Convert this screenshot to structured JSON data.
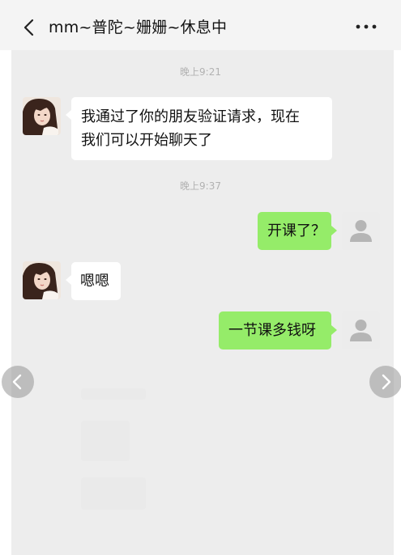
{
  "header": {
    "title": "mm~普陀~姗姗~休息中",
    "back_icon": "chevron-left-icon",
    "more_icon": "more-dots-icon"
  },
  "messages": {
    "time1": "晚上9:21",
    "msg1_line1": "我通过了你的朋友验证请求，现在",
    "msg1_line2": "我们可以开始聊天了",
    "time2": "晚上9:37",
    "msg2": "开课了？",
    "msg3": "嗯嗯",
    "msg4": "一节课多钱呀"
  },
  "viewer": {
    "prev_icon": "chevron-left-icon",
    "next_icon": "chevron-right-icon"
  },
  "colors": {
    "sent_bubble": "#95ec69",
    "received_bubble": "#ffffff",
    "chat_background": "#ededed",
    "timestamp": "#b2b2b2"
  }
}
